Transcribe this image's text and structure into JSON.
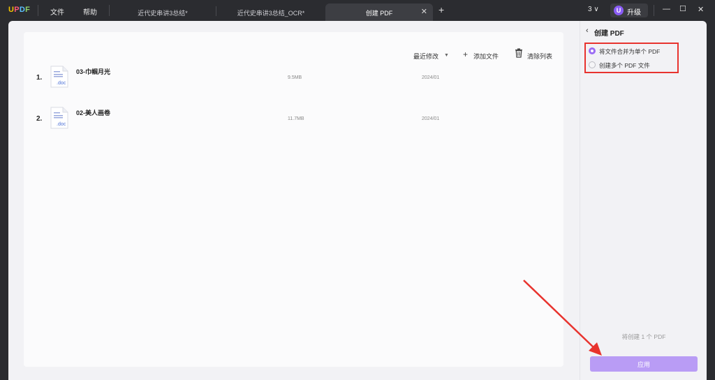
{
  "app": {
    "logo": {
      "u": "U",
      "p": "P",
      "d": "D",
      "f": "F"
    }
  },
  "menu": {
    "file": "文件",
    "help": "帮助"
  },
  "tabs": [
    {
      "label": "近代史串讲3总结*"
    },
    {
      "label": "近代史串讲3总结_OCR*"
    },
    {
      "label": "创建 PDF"
    }
  ],
  "window": {
    "count": "3",
    "upgrade_avatar": "U",
    "upgrade_label": "升级"
  },
  "toolbar": {
    "sort_label": "最近修改",
    "add_label": "添加文件",
    "clear_label": "清除列表"
  },
  "files": [
    {
      "index": "1.",
      "name": "03-巾帼月光",
      "ext": ".doc",
      "size": "9.5MB",
      "date": "2024/01"
    },
    {
      "index": "2.",
      "name": "02-美人画卷",
      "ext": ".doc",
      "size": "11.7MB",
      "date": "2024/01"
    }
  ],
  "panel": {
    "title": "创建 PDF",
    "options": [
      {
        "label": "将文件合并为单个 PDF",
        "selected": true
      },
      {
        "label": "创建多个 PDF 文件",
        "selected": false
      }
    ],
    "summary": "将创建 1 个 PDF",
    "apply_label": "应用"
  },
  "colors": {
    "accent": "#9b6cf4",
    "apply": "#b99cf5",
    "highlight": "#e8332e"
  }
}
